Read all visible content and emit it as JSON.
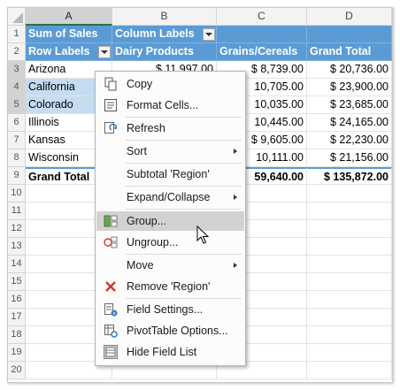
{
  "columns": [
    "A",
    "B",
    "C",
    "D"
  ],
  "selected_column": "A",
  "row_numbers": [
    "1",
    "2",
    "3",
    "4",
    "5",
    "6",
    "7",
    "8",
    "9",
    "10",
    "11",
    "12",
    "13",
    "14",
    "15",
    "16",
    "17",
    "18",
    "19",
    "20"
  ],
  "selected_rows": [
    "3",
    "4",
    "5"
  ],
  "pivot": {
    "row1": {
      "a": "Sum of Sales",
      "b": "Column Labels"
    },
    "row2": {
      "a": "Row Labels",
      "b": "Dairy Products",
      "c": "Grains/Cereals",
      "d": "Grand Total"
    },
    "data_rows": [
      {
        "region": "Arizona",
        "b": "$ 11,997.00",
        "c": "$ 8,739.00",
        "d": "$ 20,736.00"
      },
      {
        "region": "California",
        "b": "",
        "c": "10,705.00",
        "d": "$ 23,900.00"
      },
      {
        "region": "Colorado",
        "b": "",
        "c": "10,035.00",
        "d": "$ 23,685.00"
      },
      {
        "region": "Illinois",
        "b": "",
        "c": "10,445.00",
        "d": "$ 24,165.00"
      },
      {
        "region": "Kansas",
        "b": "",
        "c": "$ 9,605.00",
        "d": "$ 22,230.00"
      },
      {
        "region": "Wisconsin",
        "b": "",
        "c": "10,111.00",
        "d": "$ 21,156.00"
      }
    ],
    "grand_total": {
      "a": "Grand Total",
      "b": "",
      "c": "59,640.00",
      "d": "$ 135,872.00"
    }
  },
  "context_menu": {
    "items": [
      {
        "label": "Copy",
        "icon": "copy-icon"
      },
      {
        "label": "Format Cells...",
        "icon": "format-cells-icon"
      },
      {
        "label": "Refresh",
        "icon": "refresh-icon"
      },
      {
        "label": "Sort",
        "icon": "",
        "submenu": true
      },
      {
        "label": "Subtotal 'Region'",
        "icon": ""
      },
      {
        "label": "Expand/Collapse",
        "icon": "",
        "submenu": true
      },
      {
        "label": "Group...",
        "icon": "group-icon",
        "highlighted": true
      },
      {
        "label": "Ungroup...",
        "icon": "ungroup-icon"
      },
      {
        "label": "Move",
        "icon": "",
        "submenu": true
      },
      {
        "label": "Remove 'Region'",
        "icon": "remove-icon"
      },
      {
        "label": "Field Settings...",
        "icon": "field-settings-icon"
      },
      {
        "label": "PivotTable Options...",
        "icon": "pivot-options-icon"
      },
      {
        "label": "Hide Field List",
        "icon": "field-list-icon"
      }
    ]
  },
  "colors": {
    "header_blue": "#5b9bd5",
    "selection_fill": "#c5dcf2",
    "menu_highlight": "#d2d2d2",
    "remove_red": "#d9342b"
  }
}
